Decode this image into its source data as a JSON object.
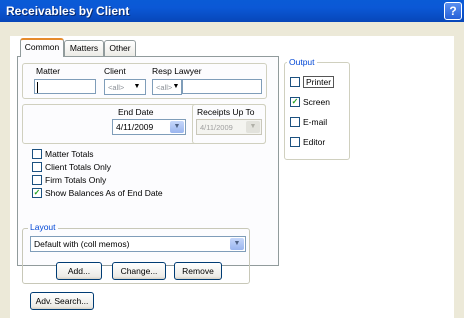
{
  "window": {
    "title": "Receivables by Client",
    "help_glyph": "?"
  },
  "tabs": [
    {
      "label": "Common",
      "active": true
    },
    {
      "label": "Matters",
      "active": false
    },
    {
      "label": "Other",
      "active": false
    }
  ],
  "filters": {
    "matter_label": "Matter",
    "matter_value": "",
    "client_label": "Client",
    "client_value": "<all>",
    "resp_lawyer_label": "Resp Lawyer",
    "resp_lawyer_value": "<all>"
  },
  "dates": {
    "end_date_label": "End Date",
    "end_date_value": "4/11/2009",
    "receipts_up_to_label": "Receipts Up To",
    "receipts_up_to_value": "4/11/2009"
  },
  "options": [
    {
      "label": "Matter Totals",
      "checked": false
    },
    {
      "label": "Client Totals Only",
      "checked": false
    },
    {
      "label": "Firm Totals Only",
      "checked": false
    },
    {
      "label": "Show Balances As of End Date",
      "checked": true
    }
  ],
  "output": {
    "group_label": "Output",
    "items": [
      {
        "label": "Printer",
        "checked": false
      },
      {
        "label": "Screen",
        "checked": true
      },
      {
        "label": "E-mail",
        "checked": false
      },
      {
        "label": "Editor",
        "checked": false
      }
    ]
  },
  "layout": {
    "group_label": "Layout",
    "selected": "Default with (coll memos)",
    "add_label": "Add...",
    "change_label": "Change...",
    "remove_label": "Remove"
  },
  "adv_search_label": "Adv. Search...",
  "check_glyph": "✓",
  "dropdown_glyph": "▼"
}
